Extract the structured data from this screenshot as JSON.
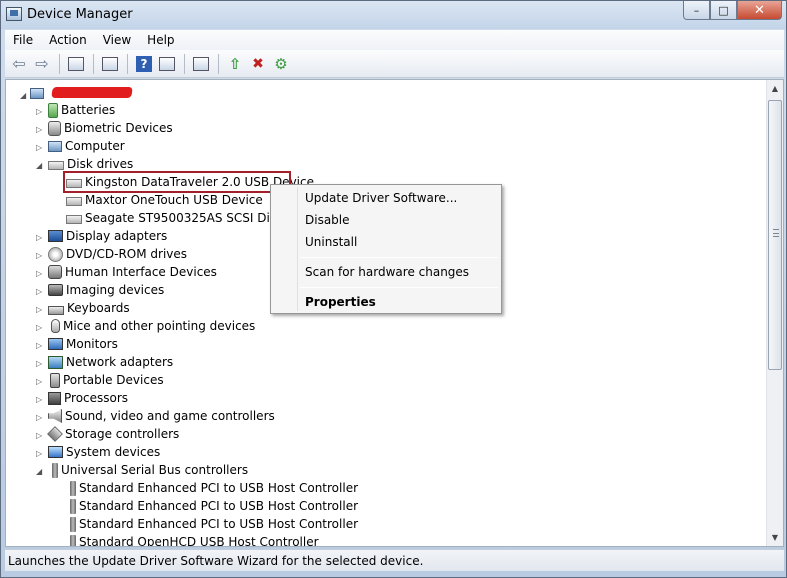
{
  "window": {
    "title": "Device Manager",
    "caption": {
      "minimize": "–",
      "maximize": "□",
      "close": "✕"
    }
  },
  "menu": {
    "items": [
      "File",
      "Action",
      "View",
      "Help"
    ]
  },
  "toolbar": {
    "buttons": [
      "back-icon",
      "forward-icon",
      "show-hide-tree-icon",
      "properties-icon",
      "help-icon",
      "view-icon",
      "scan-hardware-icon",
      "update-driver-icon",
      "disable-device-icon",
      "uninstall-device-icon"
    ]
  },
  "tree": {
    "root_label": "",
    "categories": [
      {
        "label": "Batteries",
        "icon": "battery-icon",
        "expanded": false
      },
      {
        "label": "Biometric Devices",
        "icon": "biometric-icon",
        "expanded": false
      },
      {
        "label": "Computer",
        "icon": "computer-icon",
        "expanded": false
      },
      {
        "label": "Disk drives",
        "icon": "disk-drive-icon",
        "expanded": true,
        "children": [
          {
            "label": "Kingston DataTraveler 2.0 USB Device",
            "selected": true
          },
          {
            "label": "Maxtor OneTouch USB Device"
          },
          {
            "label": "Seagate ST9500325AS SCSI Disk Device"
          }
        ]
      },
      {
        "label": "Display adapters",
        "icon": "display-adapter-icon",
        "expanded": false
      },
      {
        "label": "DVD/CD-ROM drives",
        "icon": "cd-drive-icon",
        "expanded": false
      },
      {
        "label": "Human Interface Devices",
        "icon": "hid-icon",
        "expanded": false
      },
      {
        "label": "Imaging devices",
        "icon": "camera-icon",
        "expanded": false
      },
      {
        "label": "Keyboards",
        "icon": "keyboard-icon",
        "expanded": false
      },
      {
        "label": "Mice and other pointing devices",
        "icon": "mouse-icon",
        "expanded": false
      },
      {
        "label": "Monitors",
        "icon": "monitor-icon",
        "expanded": false
      },
      {
        "label": "Network adapters",
        "icon": "network-icon",
        "expanded": false
      },
      {
        "label": "Portable Devices",
        "icon": "portable-device-icon",
        "expanded": false
      },
      {
        "label": "Processors",
        "icon": "processor-icon",
        "expanded": false
      },
      {
        "label": "Sound, video and game controllers",
        "icon": "sound-icon",
        "expanded": false
      },
      {
        "label": "Storage controllers",
        "icon": "storage-controller-icon",
        "expanded": false
      },
      {
        "label": "System devices",
        "icon": "system-device-icon",
        "expanded": false
      },
      {
        "label": "Universal Serial Bus controllers",
        "icon": "usb-icon",
        "expanded": true,
        "children": [
          {
            "label": "Standard Enhanced PCI to USB Host Controller"
          },
          {
            "label": "Standard Enhanced PCI to USB Host Controller"
          },
          {
            "label": "Standard Enhanced PCI to USB Host Controller"
          },
          {
            "label": "Standard OpenHCD USB Host Controller"
          }
        ]
      }
    ]
  },
  "context_menu": {
    "update_driver": "Update Driver Software...",
    "disable": "Disable",
    "uninstall": "Uninstall",
    "scan": "Scan for hardware changes",
    "properties": "Properties"
  },
  "status": {
    "text": "Launches the Update Driver Software Wizard for the selected device."
  },
  "colors": {
    "selection_outline": "#a31f2a",
    "redaction": "#e11d1d"
  }
}
